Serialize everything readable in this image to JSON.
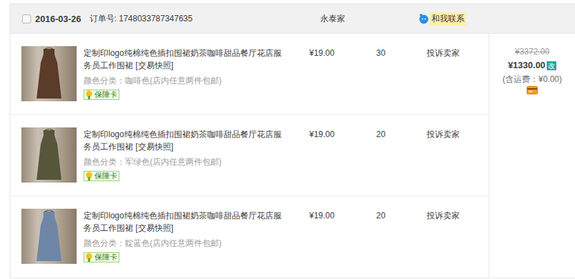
{
  "order": {
    "checked": false,
    "date": "2016-03-26",
    "order_no_label": "订单号:",
    "order_no": "1748033787347635",
    "shop": "永泰家",
    "contact": "和我联系"
  },
  "items": [
    {
      "title": "定制印logo纯棉纯色插扣围裙奶茶咖啡甜品餐厅花店服务员工作围裙",
      "snapshot": "[交易快照]",
      "variant": "颜色分类：咖啡色(店内任意两件包邮)",
      "badge": "保障卡",
      "price": "¥19.00",
      "quantity": "30",
      "action": "投诉卖家",
      "color": "#5b3b2a"
    },
    {
      "title": "定制印logo纯棉纯色插扣围裙奶茶咖啡甜品餐厅花店服务员工作围裙",
      "snapshot": "[交易快照]",
      "variant": "颜色分类：军绿色(店内任意两件包邮)",
      "badge": "保障卡",
      "price": "¥19.00",
      "quantity": "20",
      "action": "投诉卖家",
      "color": "#55563a"
    },
    {
      "title": "定制印logo纯棉纯色插扣围裙奶茶咖啡甜品餐厅花店服务员工作围裙",
      "snapshot": "[交易快照]",
      "variant": "颜色分类：靛蓝色(店内任意两件包邮)",
      "badge": "保障卡",
      "price": "¥19.00",
      "quantity": "20",
      "action": "投诉卖家",
      "color": "#6f86a6"
    }
  ],
  "total": {
    "original": "¥3372.00",
    "amount": "¥1330.00",
    "edit": "改",
    "shipping": "(含运费：¥0.00)"
  }
}
